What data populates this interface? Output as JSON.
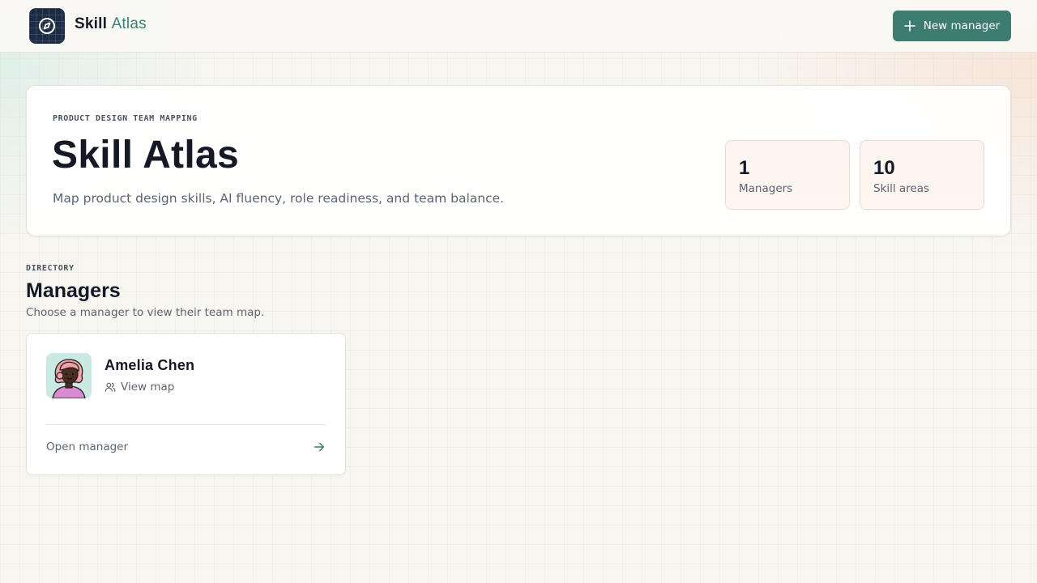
{
  "app": {
    "brand_primary": "Skill",
    "brand_accent": "Atlas",
    "logo_icon": "compass-icon",
    "accent_color": "#3c7d70"
  },
  "header": {
    "new_manager_button": {
      "icon": "plus-icon",
      "label": "New manager"
    }
  },
  "hero": {
    "eyebrow": "PRODUCT DESIGN TEAM MAPPING",
    "title": "Skill Atlas",
    "subtitle": "Map product design skills, AI fluency, role readiness, and team balance.",
    "stats": [
      {
        "value": "1",
        "label": "Managers"
      },
      {
        "value": "10",
        "label": "Skill areas"
      }
    ]
  },
  "directory": {
    "eyebrow": "DIRECTORY",
    "title": "Managers",
    "subtitle": "Choose a manager to view their team map.",
    "managers": [
      {
        "name": "Amelia Chen",
        "avatar_icon": "avatar-illustration",
        "view_map_icon": "users-icon",
        "view_map_label": "View map",
        "open_label": "Open manager",
        "open_icon": "arrow-right-icon"
      }
    ]
  }
}
